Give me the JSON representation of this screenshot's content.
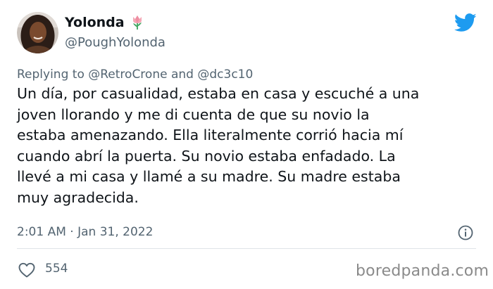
{
  "author": {
    "name": "Yolonda",
    "name_emoji_icon": "tulip-icon",
    "handle": "@PoughYolonda"
  },
  "reply": {
    "prefix": "Replying to",
    "mention_1": "@RetroCrone",
    "joiner": "and",
    "mention_2": "@dc3c10"
  },
  "tweet": {
    "lines": [
      "Un día, por casualidad, estaba en casa y escuché a una",
      "joven llorando y me di cuenta de que su novio la",
      "estaba amenazando. Ella literalmente corrió hacia mí",
      "cuando abrí la puerta. Su novio estaba enfadado. La",
      "llevé a mi casa y llamé a su madre. Su madre estaba",
      "muy agradecida."
    ],
    "timestamp": "2:01 AM · Jan 31, 2022",
    "likes": "554"
  },
  "watermark": "boredpanda.com",
  "colors": {
    "twitter_blue": "#1d9bf0",
    "text": "#0f1419",
    "secondary": "#536471"
  },
  "icons": {
    "brand": "twitter-bird-icon",
    "info": "info-icon",
    "like": "heart-icon"
  }
}
